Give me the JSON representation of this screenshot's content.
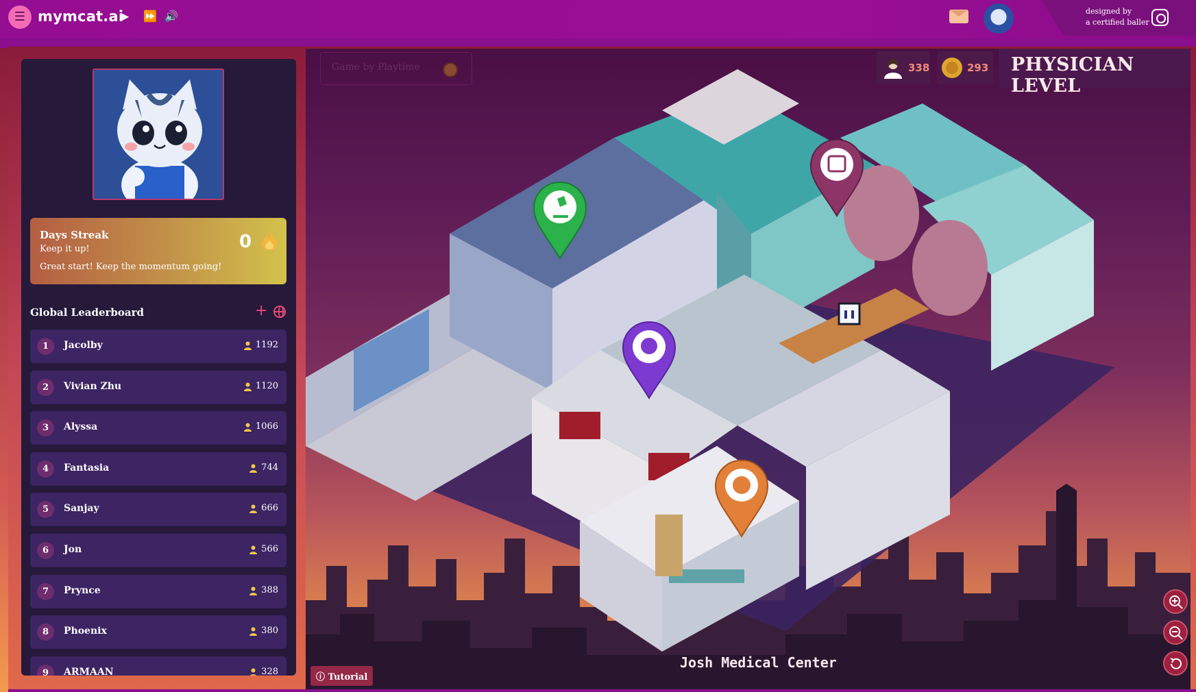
{
  "topbar": {
    "brand": "mymcat.ai",
    "menu_icon": "menu-icon",
    "play_icon": "play-icon",
    "fast_forward_icon": "fast-forward-icon",
    "volume_icon": "volume-icon",
    "designed_by_line1": "designed by",
    "designed_by_line2": "a certified baller"
  },
  "sidebar": {
    "streak": {
      "title": "Days Streak",
      "subtitle": "Keep it up!",
      "message": "Great start! Keep the momentum going!",
      "count": "0"
    },
    "leaderboard": {
      "title": "Global Leaderboard",
      "rows": [
        {
          "rank": "1",
          "name": "Jacolby",
          "points": "1192"
        },
        {
          "rank": "2",
          "name": "Vivian Zhu",
          "points": "1120"
        },
        {
          "rank": "3",
          "name": "Alyssa",
          "points": "1066"
        },
        {
          "rank": "4",
          "name": "Fantasia",
          "points": "744"
        },
        {
          "rank": "5",
          "name": "Sanjay",
          "points": "666"
        },
        {
          "rank": "6",
          "name": "Jon",
          "points": "566"
        },
        {
          "rank": "7",
          "name": "Prynce",
          "points": "388"
        },
        {
          "rank": "8",
          "name": "Phoenix",
          "points": "380"
        },
        {
          "rank": "9",
          "name": "ARMAAN",
          "points": "328"
        }
      ]
    }
  },
  "map": {
    "search_placeholder": "Game by Playtime",
    "patients": "338",
    "coins": "293",
    "level": "PHYSICIAN LEVEL",
    "center_name": "Josh Medical Center",
    "tutorial_label": "Tutorial",
    "colors": {
      "pin_green": "#2bb24a",
      "pin_maroon": "#8e3568",
      "pin_purple": "#7d3ad1",
      "pin_orange": "#e2803a"
    }
  }
}
